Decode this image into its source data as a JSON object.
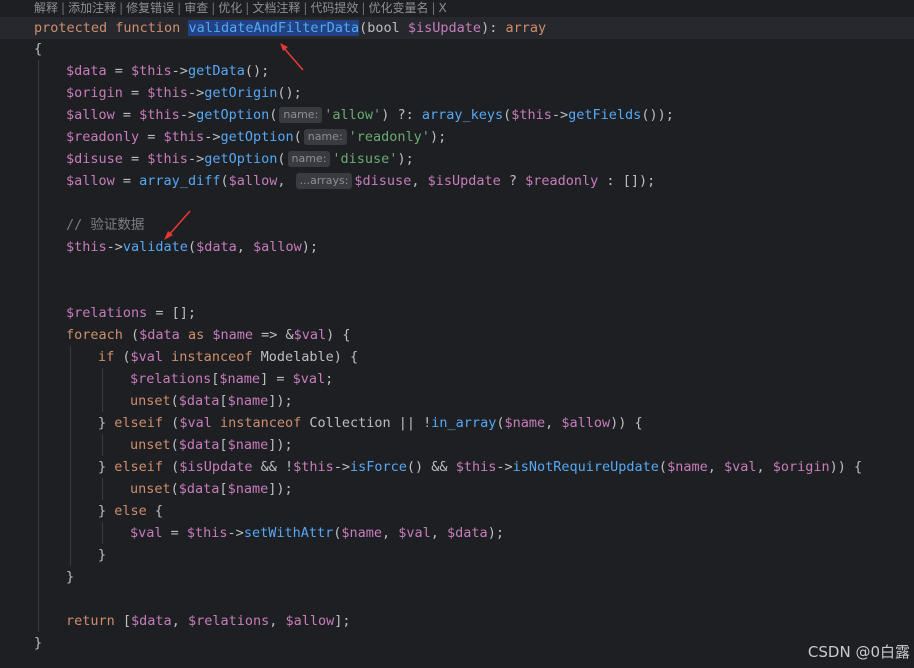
{
  "ai_actions": [
    "解释",
    "添加注释",
    "修复错误",
    "审查",
    "优化",
    "文档注释",
    "代码提效",
    "优化变量名"
  ],
  "ai_close": "X",
  "code": {
    "l1_kw": "protected function ",
    "l1_fn": "validateAndFilterData",
    "l1_p1": "(bool ",
    "l1_var": "$isUpdate",
    "l1_p2": "): ",
    "l1_kw2": "array",
    "open_brace": "{",
    "close_brace": "}",
    "l3": {
      "v1": "$data",
      "op": " = ",
      "v2": "$this",
      "arrow": "->",
      "fn": "getData",
      "end": "();"
    },
    "l4": {
      "v1": "$origin",
      "op": " = ",
      "v2": "$this",
      "arrow": "->",
      "fn": "getOrigin",
      "end": "();"
    },
    "l5": {
      "v1": "$allow",
      "op": " = ",
      "v2": "$this",
      "arrow": "->",
      "fn": "getOption",
      "p": "(",
      "hint": "name:",
      "str": "'allow'",
      "mid": ") ?: ",
      "fn2": "array_keys",
      "p2": "(",
      "v3": "$this",
      "arrow2": "->",
      "fn3": "getFields",
      "end": "());"
    },
    "l6": {
      "v1": "$readonly",
      "op": " = ",
      "v2": "$this",
      "arrow": "->",
      "fn": "getOption",
      "p": "(",
      "hint": "name:",
      "str": "'readonly'",
      "end": ");"
    },
    "l7": {
      "v1": "$disuse",
      "op": " = ",
      "v2": "$this",
      "arrow": "->",
      "fn": "getOption",
      "p": "(",
      "hint": "name:",
      "str": "'disuse'",
      "end": ");"
    },
    "l8": {
      "v1": "$allow",
      "op": " = ",
      "fn": "array_diff",
      "p": "(",
      "v2": "$allow",
      "c": ", ",
      "hint": "...arrays:",
      "v3": "$disuse",
      "c2": ", ",
      "v4": "$isUpdate",
      "q": " ? ",
      "v5": "$readonly",
      "colon": " : ",
      "end": "[]);"
    },
    "comment": "// 验证数据",
    "l11": {
      "v1": "$this",
      "arrow": "->",
      "fn": "validate",
      "p": "(",
      "v2": "$data",
      "c": ", ",
      "v3": "$allow",
      "end": ");"
    },
    "l14": {
      "v1": "$relations",
      "end": " = [];"
    },
    "l15": {
      "kw": "foreach",
      "p": " (",
      "v1": "$data",
      "as": " as ",
      "v2": "$name",
      "arrow": " => &",
      "v3": "$val",
      "end": ") {"
    },
    "l16": {
      "kw": "if",
      "p": " (",
      "v1": "$val",
      "kw2": " instanceof ",
      "cls": "Modelable",
      "end": ") {"
    },
    "l17": {
      "v1": "$relations",
      "b": "[",
      "v2": "$name",
      "op": "] = ",
      "v3": "$val",
      "end": ";"
    },
    "l18": {
      "fn": "unset",
      "p": "(",
      "v1": "$data",
      "b": "[",
      "v2": "$name",
      "end": "]);"
    },
    "l19": {
      "pre": "} ",
      "kw": "elseif",
      "p": " (",
      "v1": "$val",
      "kw2": " instanceof ",
      "cls": "Collection",
      "op": " || !",
      "fn": "in_array",
      "p2": "(",
      "v2": "$name",
      "c": ", ",
      "v3": "$allow",
      "end": ")) {"
    },
    "l20": {
      "fn": "unset",
      "p": "(",
      "v1": "$data",
      "b": "[",
      "v2": "$name",
      "end": "]);"
    },
    "l21": {
      "pre": "} ",
      "kw": "elseif",
      "p": " (",
      "v1": "$isUpdate",
      "op": " && !",
      "v2": "$this",
      "arrow": "->",
      "fn": "isForce",
      "op2": "() && ",
      "v3": "$this",
      "arrow2": "->",
      "fn2": "isNotRequireUpdate",
      "p2": "(",
      "v4": "$name",
      "c": ", ",
      "v5": "$val",
      "c2": ", ",
      "v6": "$origin",
      "end": ")) {"
    },
    "l22": {
      "fn": "unset",
      "p": "(",
      "v1": "$data",
      "b": "[",
      "v2": "$name",
      "end": "]);"
    },
    "l23": {
      "pre": "} ",
      "kw": "else",
      "end": " {"
    },
    "l24": {
      "v1": "$val",
      "op": " = ",
      "v2": "$this",
      "arrow": "->",
      "fn": "setWithAttr",
      "p": "(",
      "v3": "$name",
      "c": ", ",
      "v4": "$val",
      "c2": ", ",
      "v5": "$data",
      "end": ");"
    },
    "l25": "}",
    "l26": "}",
    "l28": {
      "kw": "return",
      "p": " [",
      "v1": "$data",
      "c": ", ",
      "v2": "$relations",
      "c2": ", ",
      "v3": "$allow",
      "end": "];"
    }
  },
  "watermark": "CSDN @0白露",
  "colors": {
    "background": "#1e1f22",
    "keyword": "#cf8e6d",
    "variable": "#c77dbb",
    "function": "#56a8f5",
    "string": "#6aab73",
    "arrow": "#e53935"
  }
}
